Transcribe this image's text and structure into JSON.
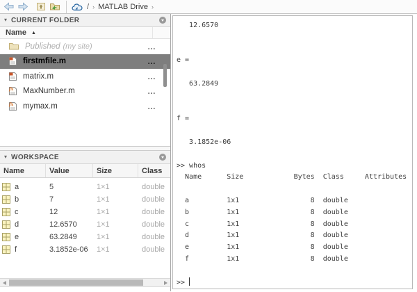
{
  "toolbar": {
    "breadcrumb": {
      "root": "/",
      "drive_label": "MATLAB Drive"
    }
  },
  "icons": {
    "collapse": "▾",
    "sort_asc": "▲",
    "menu_dots": "…",
    "crumb_sep": "›"
  },
  "current_folder": {
    "title": "CURRENT FOLDER",
    "name_column": "Name",
    "files": [
      {
        "name": "Published",
        "suffix": "(my site)",
        "type": "folder"
      },
      {
        "name": "firstmfile.m",
        "type": "script",
        "selected": true
      },
      {
        "name": "matrix.m",
        "type": "script"
      },
      {
        "name": "MaxNumber.m",
        "type": "function"
      },
      {
        "name": "mymax.m",
        "type": "function"
      }
    ]
  },
  "workspace": {
    "title": "WORKSPACE",
    "columns": {
      "name": "Name",
      "value": "Value",
      "size": "Size",
      "class": "Class"
    },
    "variables": [
      {
        "name": "a",
        "value": "5",
        "size": "1×1",
        "class": "double"
      },
      {
        "name": "b",
        "value": "7",
        "size": "1×1",
        "class": "double"
      },
      {
        "name": "c",
        "value": "12",
        "size": "1×1",
        "class": "double"
      },
      {
        "name": "d",
        "value": "12.6570",
        "size": "1×1",
        "class": "double"
      },
      {
        "name": "e",
        "value": "63.2849",
        "size": "1×1",
        "class": "double"
      },
      {
        "name": "f",
        "value": "3.1852e-06",
        "size": "1×1",
        "class": "double"
      }
    ]
  },
  "command_window": {
    "text": "   12.6570\n\n\ne =\n\n   63.2849\n\n\nf =\n\n   3.1852e-06\n\n>> whos\n  Name      Size            Bytes  Class     Attributes\n\n  a         1x1                 8  double    \n  b         1x1                 8  double    \n  c         1x1                 8  double    \n  d         1x1                 8  double    \n  e         1x1                 8  double    \n  f         1x1                 8  double    \n\n>> "
  },
  "colors": {
    "selected_row": "#7e7e7e",
    "panel_header_bg": "#f1f1f1",
    "accent_cloud_blue": "#2765a0",
    "function_orange": "#d2691e",
    "grid_icon_yellow": "#faf3c0"
  }
}
